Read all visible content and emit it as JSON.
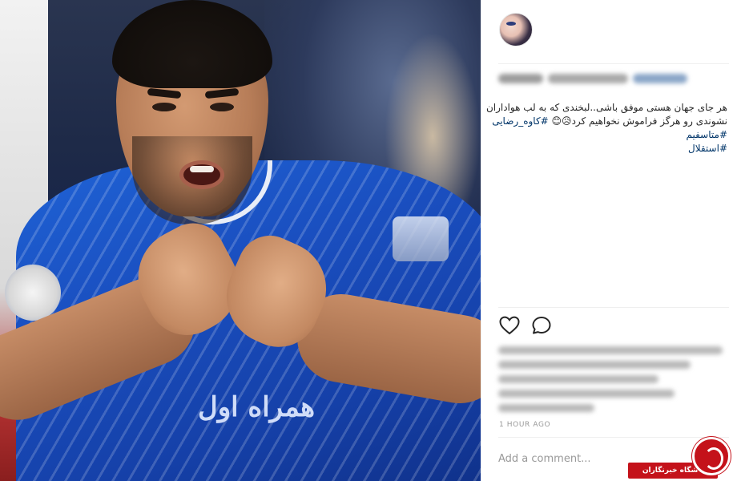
{
  "post": {
    "caption_lines": [
      "هر جای جهان هستی موفق باشی..لبخندی که به لب هواداران",
      "نشوندی رو هرگز فراموش نخواهیم کرد😥😊 #کاوه_رضایی",
      "#متاسفیم",
      "#استقلال"
    ],
    "caption_plain_line1": "هر جای جهان هستی موفق باشی..لبخندی که به لب هواداران",
    "caption_line2_text": "نشوندی رو هرگز فراموش نخواهیم کرد😥😊",
    "caption_line2_tag": "#کاوه_رضایی",
    "tag_2": "#متاسفیم",
    "tag_3": "#استقلال",
    "timestamp": "1 HOUR AGO",
    "comment_placeholder": "Add a comment..."
  },
  "photo": {
    "jersey_sponsor": "همراه اول"
  },
  "watermark": {
    "label": "باشگاه خبرنگاران",
    "color": "#c4121a"
  },
  "icons": {
    "like": "heart-icon",
    "comment": "comment-bubble-icon"
  },
  "colors": {
    "hashtag": "#003569",
    "muted": "#999999",
    "jersey_blue": "#1a4fc0"
  }
}
